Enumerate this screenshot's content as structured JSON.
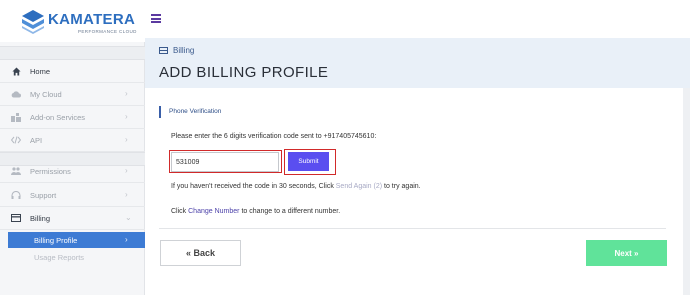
{
  "brand": {
    "name": "KAMATERA",
    "tagline": "PERFORMANCE CLOUD"
  },
  "sidebar": {
    "items": [
      {
        "label": "Home",
        "icon": "home-icon",
        "chevron": ""
      },
      {
        "label": "My Cloud",
        "icon": "cloud-icon",
        "chevron": "›"
      },
      {
        "label": "Add-on Services",
        "icon": "addon-icon",
        "chevron": "›"
      },
      {
        "label": "API",
        "icon": "code-icon",
        "chevron": "›"
      },
      {
        "label": "Permissions",
        "icon": "users-icon",
        "chevron": "›"
      },
      {
        "label": "Support",
        "icon": "headset-icon",
        "chevron": "›"
      },
      {
        "label": "Billing",
        "icon": "card-icon",
        "chevron": "⌄"
      }
    ],
    "billing_sub": [
      {
        "label": "Billing Profile",
        "chevron": "›"
      },
      {
        "label": "Usage Reports"
      }
    ]
  },
  "header": {
    "breadcrumb": "Billing",
    "title": "ADD BILLING PROFILE"
  },
  "section": {
    "title": "Phone Verification",
    "instruction": "Please enter the 6 digits verification code sent to +917405745610:",
    "code_value": "531009",
    "submit_label": "Submit",
    "resend_prefix": "If you haven't received the code in 30 seconds, Click ",
    "resend_link": "Send Again (2)",
    "resend_suffix": " to try again.",
    "change_prefix": "Click ",
    "change_link": "Change Number",
    "change_suffix": " to change to a different number."
  },
  "footer": {
    "back_label": "« Back",
    "next_label": "Next »"
  },
  "colors": {
    "brand_blue": "#2d6ebf",
    "submit_purple": "#5a4ef0",
    "next_green": "#60e39a",
    "highlight_red": "#d12a2a",
    "sidebar_selected": "#3d7bd4"
  }
}
